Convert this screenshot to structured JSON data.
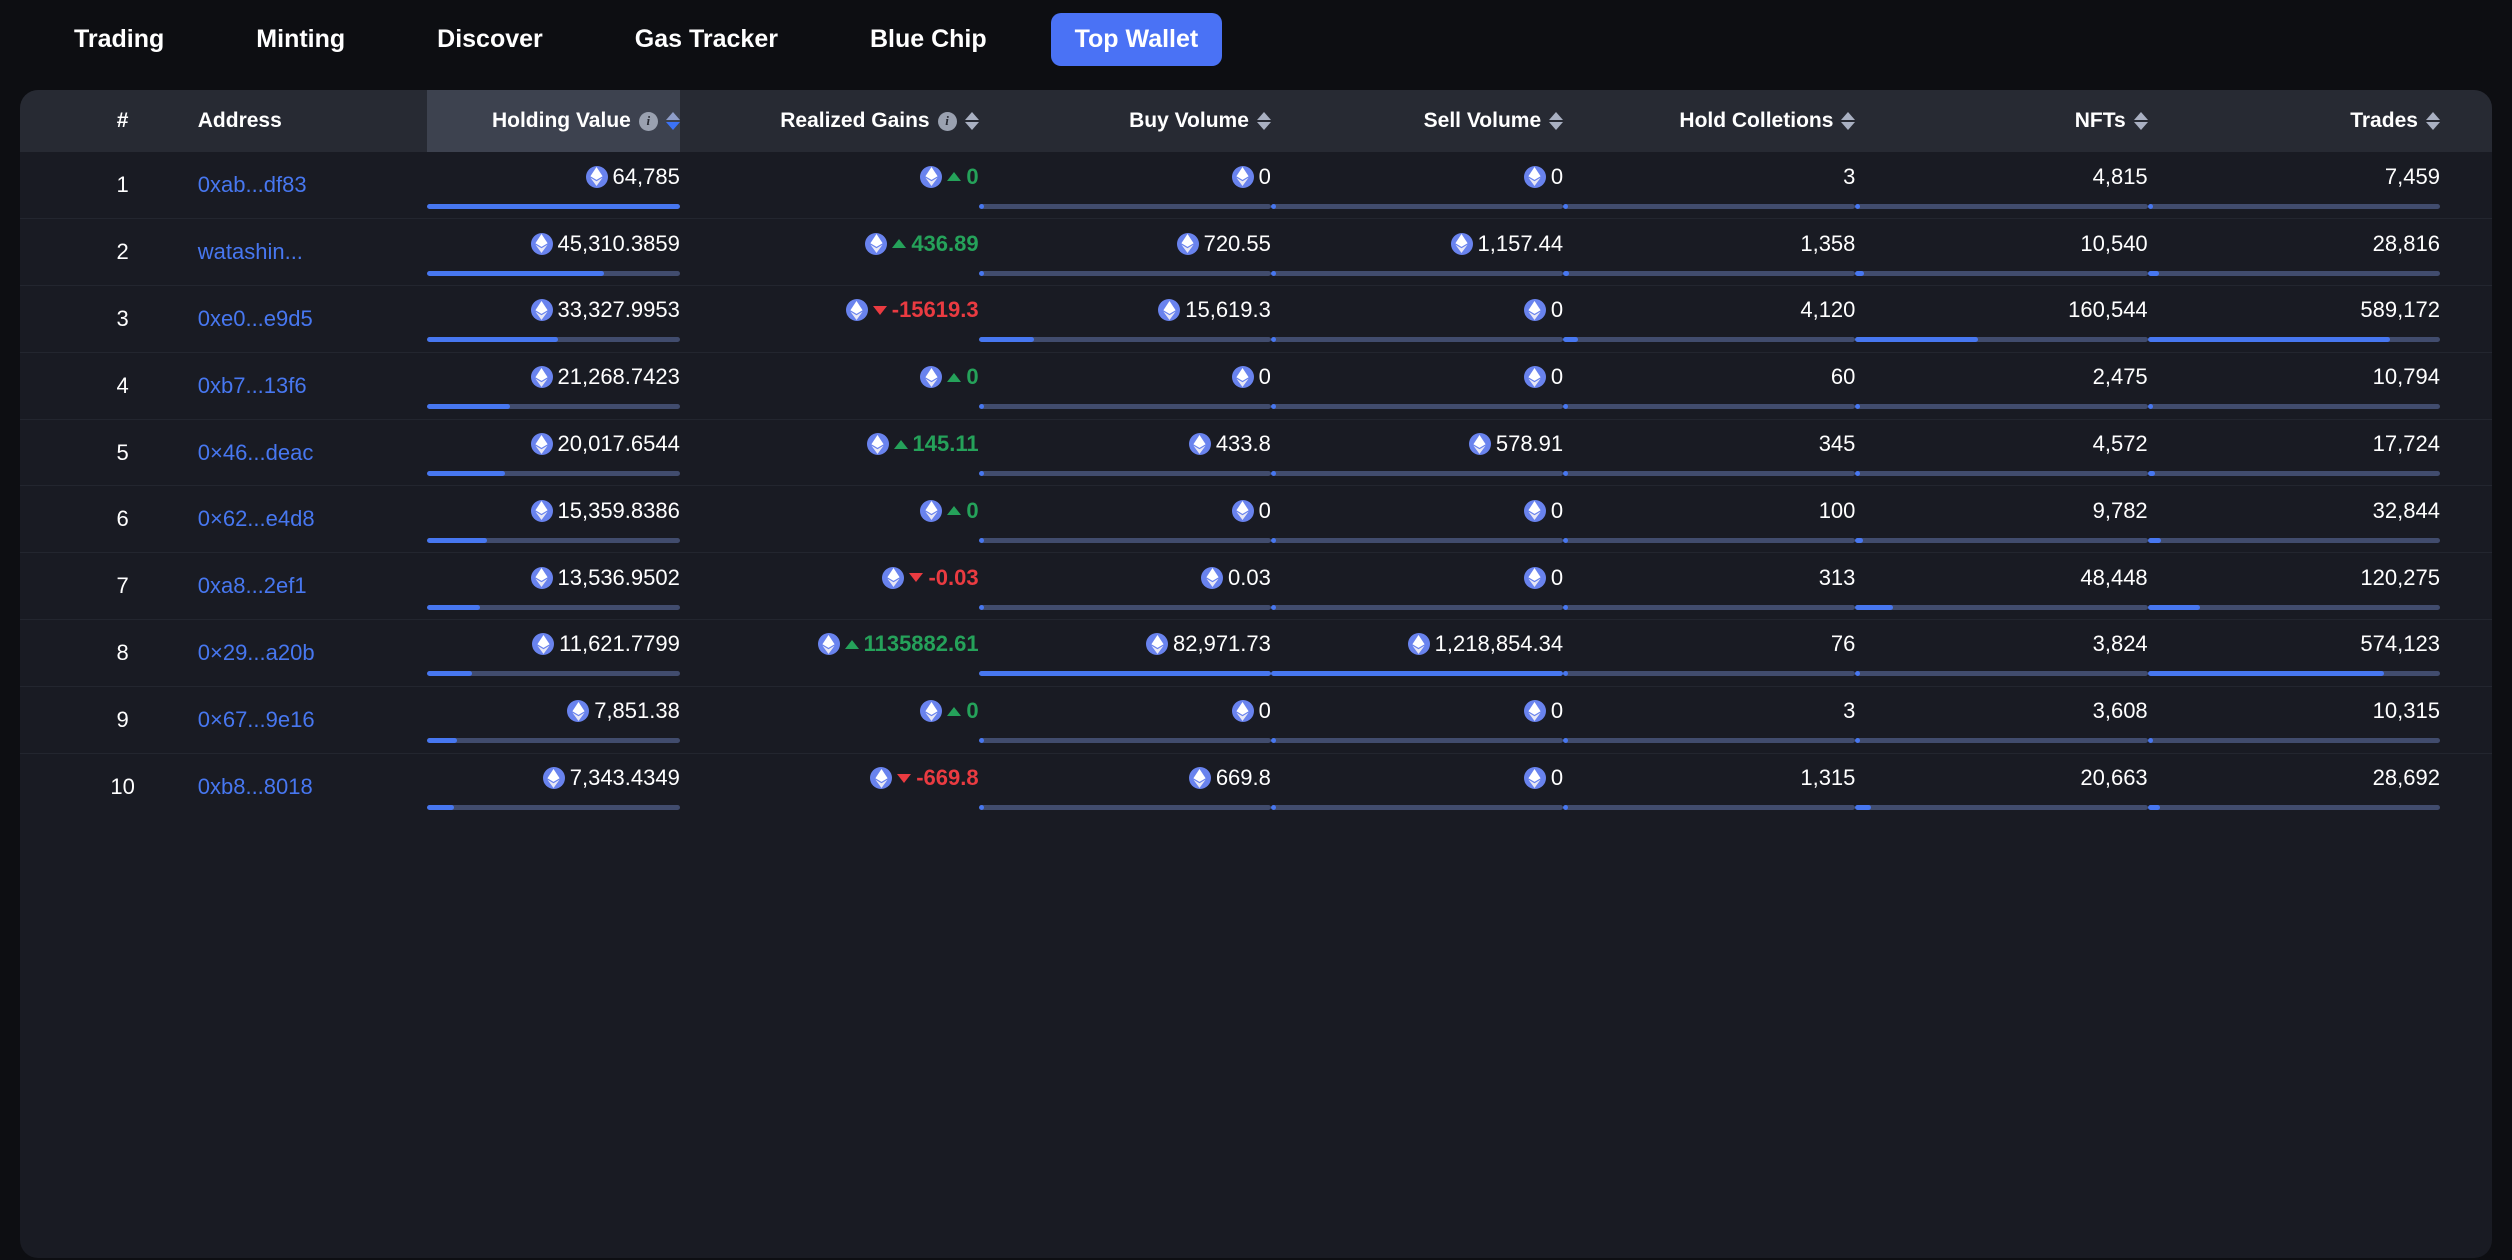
{
  "nav": {
    "items": [
      {
        "label": "Trading",
        "active": false
      },
      {
        "label": "Minting",
        "active": false
      },
      {
        "label": "Discover",
        "active": false
      },
      {
        "label": "Gas Tracker",
        "active": false
      },
      {
        "label": "Blue Chip",
        "active": false
      },
      {
        "label": "Top Wallet",
        "active": true
      }
    ]
  },
  "colors": {
    "accent": "#4777f0",
    "positive": "#25a25a",
    "negative": "#ea3b41",
    "page_bg": "#0d0e12",
    "card_bg": "#191b23",
    "header_bg": "#272a33",
    "sorted_header_bg": "#3d424f",
    "bar_track": "#414c6d",
    "eth_token": "#6983ee"
  },
  "table": {
    "columns": [
      {
        "key": "rank",
        "label": "#",
        "align": "center",
        "info": false,
        "sortable": false,
        "sorted": null
      },
      {
        "key": "address",
        "label": "Address",
        "align": "left",
        "info": false,
        "sortable": false,
        "sorted": null
      },
      {
        "key": "holding",
        "label": "Holding Value",
        "align": "right",
        "info": true,
        "sortable": true,
        "sorted": "desc"
      },
      {
        "key": "gains",
        "label": "Realized Gains",
        "align": "right",
        "info": true,
        "sortable": true,
        "sorted": null
      },
      {
        "key": "buy",
        "label": "Buy Volume",
        "align": "right",
        "info": false,
        "sortable": true,
        "sorted": null
      },
      {
        "key": "sell",
        "label": "Sell Volume",
        "align": "right",
        "info": false,
        "sortable": true,
        "sorted": null
      },
      {
        "key": "coll",
        "label": "Hold Colletions",
        "align": "right",
        "info": false,
        "sortable": true,
        "sorted": null
      },
      {
        "key": "nfts",
        "label": "NFTs",
        "align": "right",
        "info": false,
        "sortable": true,
        "sorted": null
      },
      {
        "key": "trades",
        "label": "Trades",
        "align": "right",
        "info": false,
        "sortable": true,
        "sorted": null
      }
    ],
    "rows": [
      {
        "rank": "1",
        "address": "0xab...df83",
        "holding": "64,785",
        "holding_pct": 100,
        "gains": "0",
        "gains_dir": "up",
        "buy": "0",
        "buy_pct": 0,
        "sell": "0",
        "sell_pct": 0,
        "coll": "3",
        "coll_pct": 0,
        "nfts": "4,815",
        "nfts_pct": 1.5,
        "trades": "7,459",
        "trades_pct": 1.3
      },
      {
        "rank": "2",
        "address": "watashin...",
        "holding": "45,310.3859",
        "holding_pct": 70,
        "gains": "436.89",
        "gains_dir": "up",
        "buy": "720.55",
        "buy_pct": 1,
        "sell": "1,157.44",
        "sell_pct": 1,
        "coll": "1,358",
        "coll_pct": 2,
        "nfts": "10,540",
        "nfts_pct": 3,
        "trades": "28,816",
        "trades_pct": 4
      },
      {
        "rank": "3",
        "address": "0xe0...e9d5",
        "holding": "33,327.9953",
        "holding_pct": 52,
        "gains": "-15619.3",
        "gains_dir": "down",
        "buy": "15,619.3",
        "buy_pct": 19,
        "sell": "0",
        "sell_pct": 0,
        "coll": "4,120",
        "coll_pct": 5,
        "nfts": "160,544",
        "nfts_pct": 42,
        "trades": "589,172",
        "trades_pct": 83
      },
      {
        "rank": "4",
        "address": "0xb7...13f6",
        "holding": "21,268.7423",
        "holding_pct": 33,
        "gains": "0",
        "gains_dir": "up",
        "buy": "0",
        "buy_pct": 0,
        "sell": "0",
        "sell_pct": 0,
        "coll": "60",
        "coll_pct": 0,
        "nfts": "2,475",
        "nfts_pct": 1,
        "trades": "10,794",
        "trades_pct": 1.8
      },
      {
        "rank": "5",
        "address": "0×46...deac",
        "holding": "20,017.6544",
        "holding_pct": 31,
        "gains": "145.11",
        "gains_dir": "up",
        "buy": "433.8",
        "buy_pct": 0.6,
        "sell": "578.91",
        "sell_pct": 0.5,
        "coll": "345",
        "coll_pct": 0.4,
        "nfts": "4,572",
        "nfts_pct": 1.4,
        "trades": "17,724",
        "trades_pct": 2.6
      },
      {
        "rank": "6",
        "address": "0×62...e4d8",
        "holding": "15,359.8386",
        "holding_pct": 24,
        "gains": "0",
        "gains_dir": "up",
        "buy": "0",
        "buy_pct": 0,
        "sell": "0",
        "sell_pct": 0,
        "coll": "100",
        "coll_pct": 0,
        "nfts": "9,782",
        "nfts_pct": 2.7,
        "trades": "32,844",
        "trades_pct": 4.7
      },
      {
        "rank": "7",
        "address": "0xa8...2ef1",
        "holding": "13,536.9502",
        "holding_pct": 21,
        "gains": "-0.03",
        "gains_dir": "down",
        "buy": "0.03",
        "buy_pct": 0,
        "sell": "0",
        "sell_pct": 0,
        "coll": "313",
        "coll_pct": 0.3,
        "nfts": "48,448",
        "nfts_pct": 13,
        "trades": "120,275",
        "trades_pct": 18
      },
      {
        "rank": "8",
        "address": "0×29...a20b",
        "holding": "11,621.7799",
        "holding_pct": 18,
        "gains": "1135882.61",
        "gains_dir": "up",
        "buy": "82,971.73",
        "buy_pct": 100,
        "sell": "1,218,854.34",
        "sell_pct": 100,
        "coll": "76",
        "coll_pct": 0,
        "nfts": "3,824",
        "nfts_pct": 1,
        "trades": "574,123",
        "trades_pct": 81
      },
      {
        "rank": "9",
        "address": "0×67...9e16",
        "holding": "7,851.38",
        "holding_pct": 12,
        "gains": "0",
        "gains_dir": "up",
        "buy": "0",
        "buy_pct": 0,
        "sell": "0",
        "sell_pct": 0,
        "coll": "3",
        "coll_pct": 0,
        "nfts": "3,608",
        "nfts_pct": 1,
        "trades": "10,315",
        "trades_pct": 1.6
      },
      {
        "rank": "10",
        "address": "0xb8...8018",
        "holding": "7,343.4349",
        "holding_pct": 11,
        "gains": "-669.8",
        "gains_dir": "down",
        "buy": "669.8",
        "buy_pct": 0.9,
        "sell": "0",
        "sell_pct": 0,
        "coll": "1,315",
        "coll_pct": 1.8,
        "nfts": "20,663",
        "nfts_pct": 5.5,
        "trades": "28,692",
        "trades_pct": 4.3
      }
    ]
  },
  "icons": {
    "eth": "ethereum-token-icon",
    "info": "info-icon",
    "sort": "sort-arrows-icon"
  }
}
